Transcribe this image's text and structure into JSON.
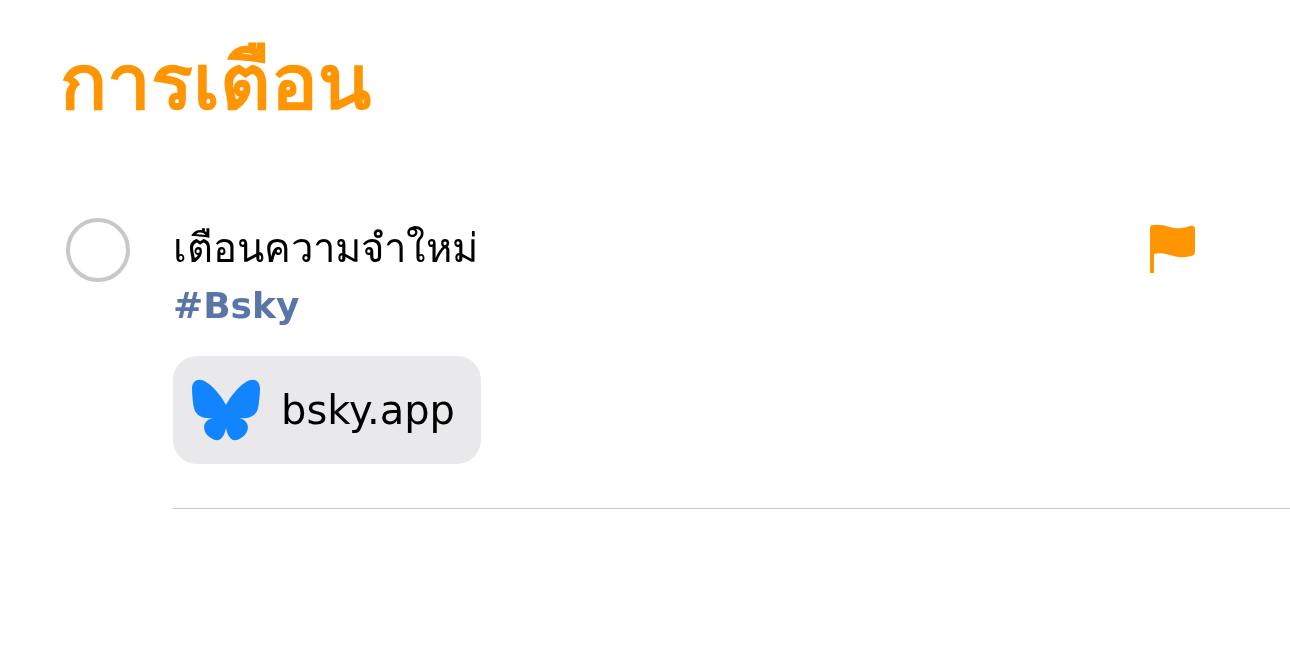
{
  "title": "การเตือน",
  "reminders": [
    {
      "title": "เตือนความจำใหม่",
      "completed": false,
      "flagged": true,
      "tags": [
        "#Bsky"
      ],
      "link": {
        "domain": "bsky.app"
      }
    }
  ]
}
